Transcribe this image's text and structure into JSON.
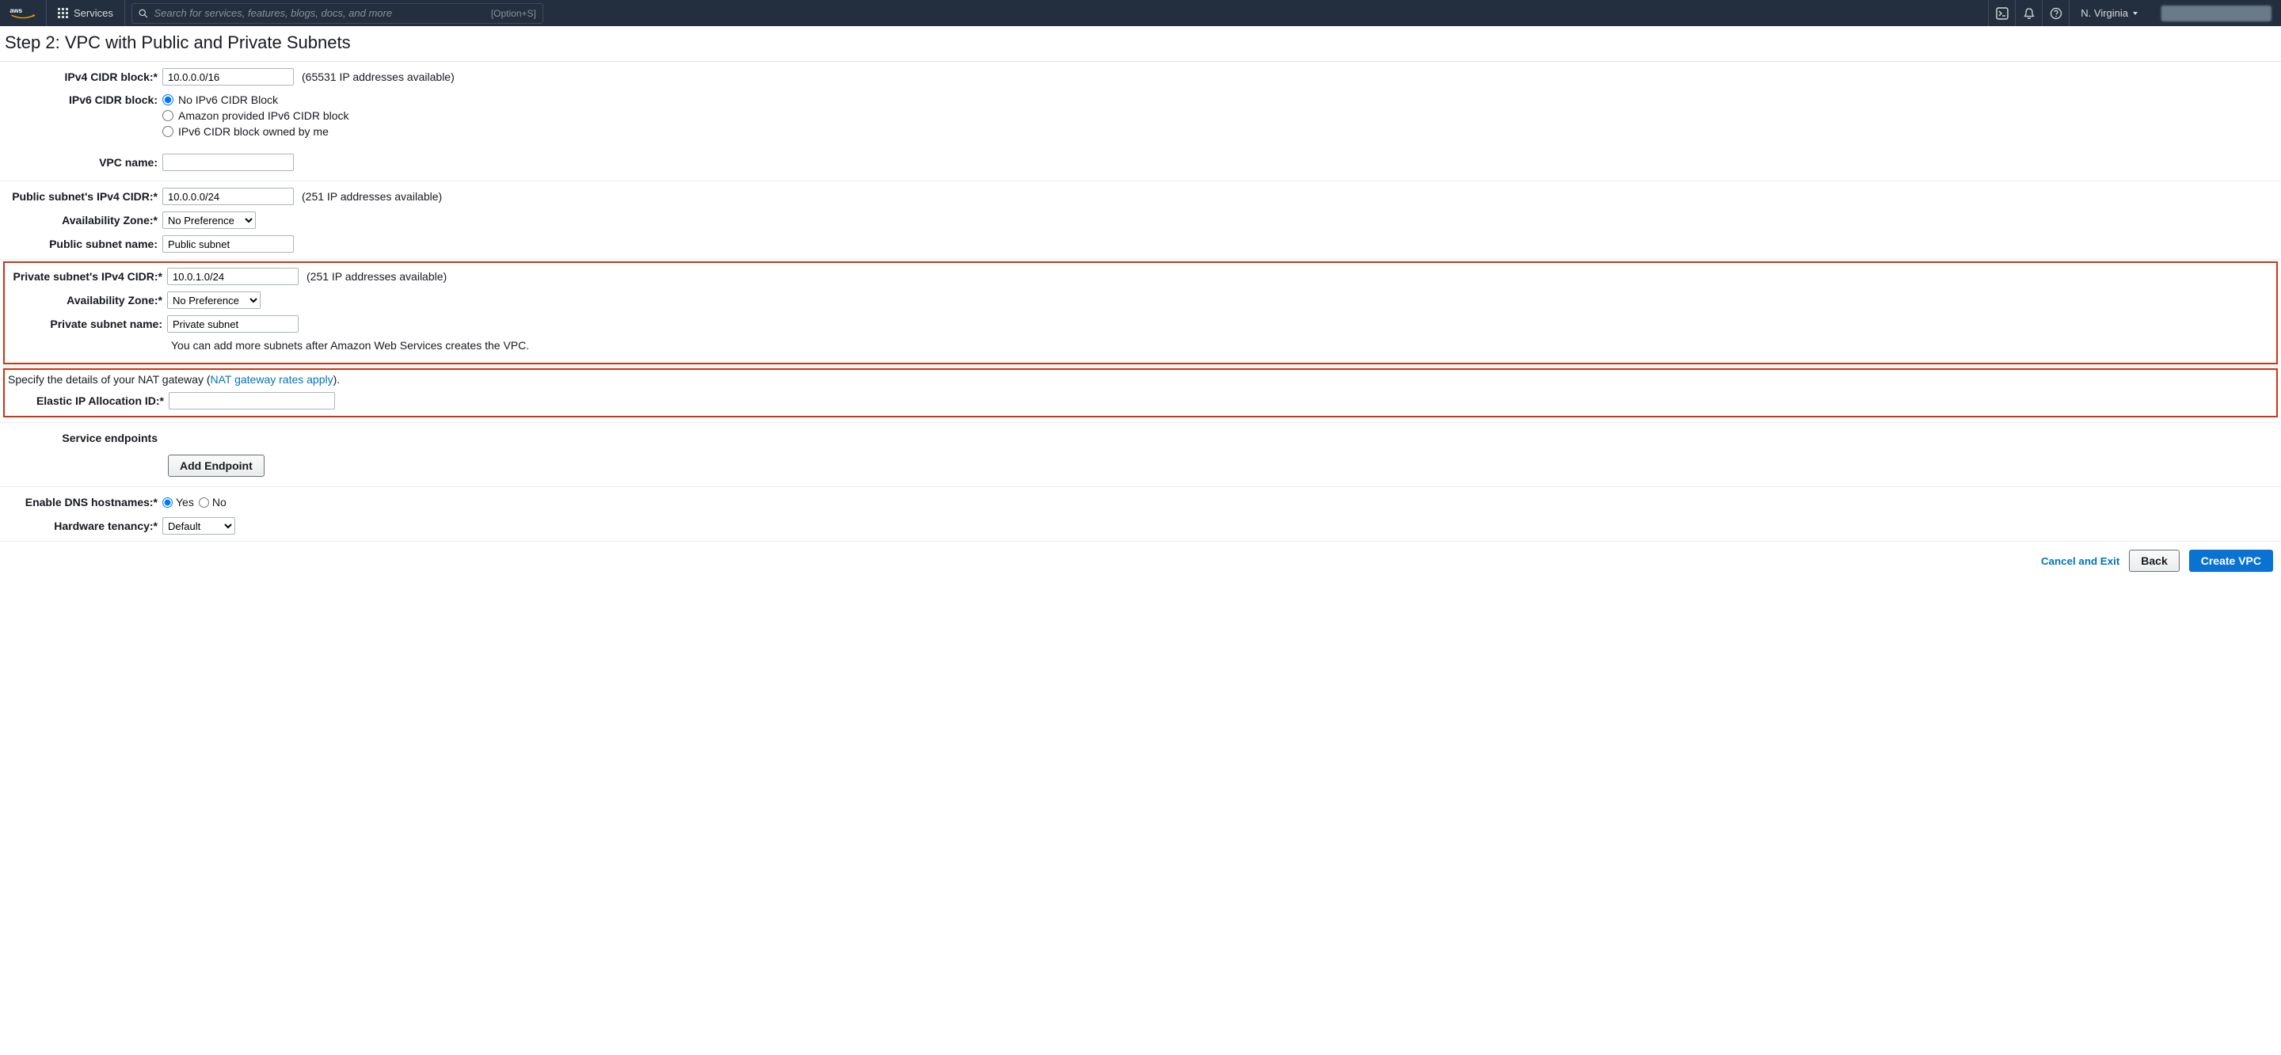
{
  "header": {
    "services_label": "Services",
    "search_placeholder": "Search for services, features, blogs, docs, and more",
    "search_hint": "[Option+S]",
    "region": "N. Virginia"
  },
  "page": {
    "title": "Step 2: VPC with Public and Private Subnets"
  },
  "form": {
    "ipv4_cidr_label": "IPv4 CIDR block:*",
    "ipv4_cidr_value": "10.0.0.0/16",
    "ipv4_cidr_help": "(65531 IP addresses available)",
    "ipv6_cidr_label": "IPv6 CIDR block:",
    "ipv6_opt_none": "No IPv6 CIDR Block",
    "ipv6_opt_amazon": "Amazon provided IPv6 CIDR block",
    "ipv6_opt_owned": "IPv6 CIDR block owned by me",
    "vpc_name_label": "VPC name:",
    "vpc_name_value": "",
    "pub_cidr_label": "Public subnet's IPv4 CIDR:*",
    "pub_cidr_value": "10.0.0.0/24",
    "pub_cidr_help": "(251 IP addresses available)",
    "pub_az_label": "Availability Zone:*",
    "pub_az_option": "No Preference",
    "pub_name_label": "Public subnet name:",
    "pub_name_value": "Public subnet",
    "priv_cidr_label": "Private subnet's IPv4 CIDR:*",
    "priv_cidr_value": "10.0.1.0/24",
    "priv_cidr_help": "(251 IP addresses available)",
    "priv_az_label": "Availability Zone:*",
    "priv_az_option": "No Preference",
    "priv_name_label": "Private subnet name:",
    "priv_name_value": "Private subnet",
    "more_subnets_hint": "You can add more subnets after Amazon Web Services creates the VPC.",
    "nat_prefix": "Specify the details of your NAT gateway (",
    "nat_link": "NAT gateway rates apply",
    "nat_suffix": ").",
    "eip_label": "Elastic IP Allocation ID:*",
    "eip_value": "",
    "endpoints_label": "Service endpoints",
    "add_endpoint": "Add Endpoint",
    "dns_label": "Enable DNS hostnames:*",
    "dns_yes": "Yes",
    "dns_no": "No",
    "tenancy_label": "Hardware tenancy:*",
    "tenancy_option": "Default"
  },
  "footer": {
    "cancel": "Cancel and Exit",
    "back": "Back",
    "create": "Create VPC"
  }
}
